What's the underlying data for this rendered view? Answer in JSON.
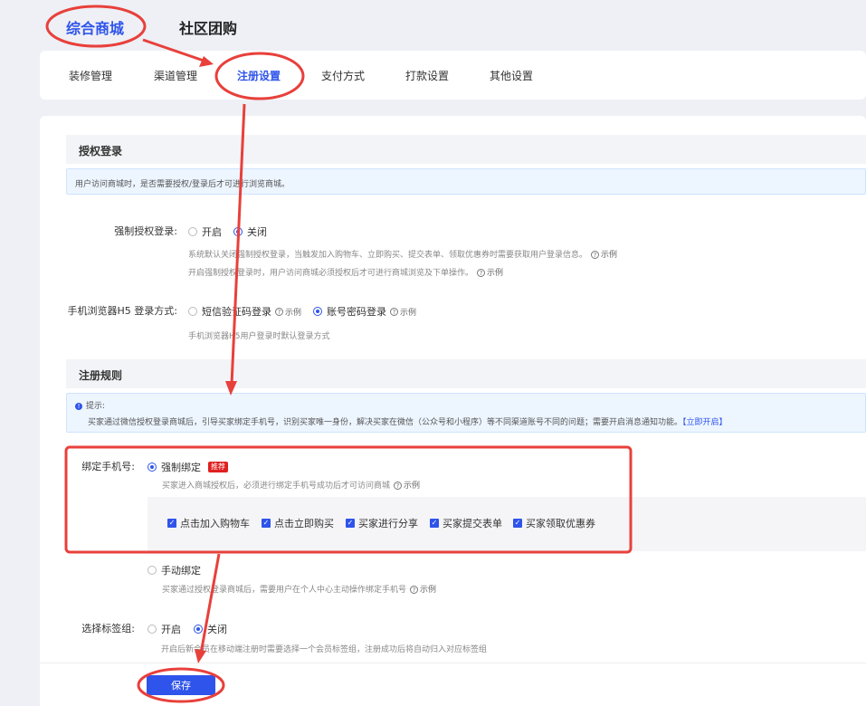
{
  "top_tabs": [
    "综合商城",
    "社区团购"
  ],
  "sub_tabs": [
    "装修管理",
    "渠道管理",
    "注册设置",
    "支付方式",
    "打款设置",
    "其他设置"
  ],
  "auth": {
    "heading": "授权登录",
    "info": "用户访问商城时，是否需要授权/登录后才可进行浏览商城。",
    "force_label": "强制授权登录:",
    "force_on": "开启",
    "force_off": "关闭",
    "force_help1": "系统默认关闭强制授权登录，当触发加入购物车、立即购买、提交表单、领取优惠券时需要获取用户登录信息。",
    "force_help2": "开启强制授权登录时，用户访问商城必须授权后才可进行商城浏览及下单操作。",
    "example": "示例",
    "h5_label": "手机浏览器H5 登录方式:",
    "h5_opt1": "短信验证码登录",
    "h5_opt2": "账号密码登录",
    "h5_help": "手机浏览器H5用户登录时默认登录方式"
  },
  "register": {
    "heading": "注册规则",
    "tip_title": "提示:",
    "tip_text": "买家通过微信授权登录商城后，引导买家绑定手机号，识别买家唯一身份，解决买家在微信（公众号和小程序）等不同渠道账号不同的问题；需要开启消息通知功能。",
    "tip_link": "【立即开启】",
    "bind_label": "绑定手机号:",
    "bind_force": "强制绑定",
    "bind_badge": "推荐",
    "bind_force_help": "买家进入商城授权后，必须进行绑定手机号成功后才可访问商城",
    "checks": [
      "点击加入购物车",
      "点击立即购买",
      "买家进行分享",
      "买家提交表单",
      "买家领取优惠券"
    ],
    "bind_manual": "手动绑定",
    "bind_manual_help": "买家通过授权登录商城后，需要用户在个人中心主动操作绑定手机号",
    "tag_label": "选择标签组:",
    "tag_on": "开启",
    "tag_off": "关闭",
    "tag_help": "开启后新会员在移动端注册时需要选择一个会员标签组，注册成功后将自动归入对应标签组"
  },
  "save_label": "保存",
  "colors": {
    "accent": "#2f54eb",
    "annotation": "#e8403b",
    "badge": "#e02020"
  }
}
